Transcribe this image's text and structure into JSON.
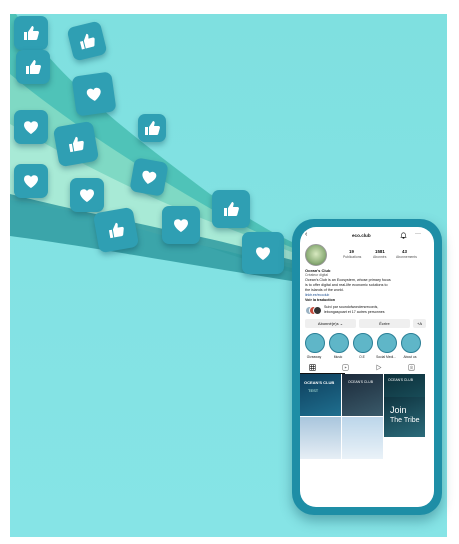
{
  "profile": {
    "username": "eco.club",
    "stats": [
      {
        "value": "19",
        "label": "Publications"
      },
      {
        "value": "1581",
        "label": "Abonnés"
      },
      {
        "value": "43",
        "label": "Abonnements"
      }
    ],
    "name": "Ocean's Club",
    "category": "Créateur digital",
    "bio": [
      "Ocean's Club is an Ecosystem, whose primary focus",
      "is to offer digital and real-life economic solutions to",
      "the islands of the world."
    ],
    "link": "linktr.ee/ecoclub",
    "translation": "Voir la traduction",
    "followed_by": [
      "Suivi par soundofwondersrecords,",
      "lebongaspoart et 17 autres personnes"
    ]
  },
  "buttons": {
    "subscribed": "Abonné(e)s ⌄",
    "write": "Écrire",
    "add_user": "+A"
  },
  "highlights": [
    "Giveaway",
    "Music",
    "O.E",
    "Social Medi...",
    "About us"
  ],
  "posts": [
    {
      "line1": "OCEAN'S CLUB",
      "line2": "TEST"
    },
    {
      "line1": "OCEAN'S CLUB",
      "line2": ""
    },
    {
      "line1": "OCEAN'S CLUB",
      "line2": ""
    },
    {
      "line1": "",
      "line2": ""
    },
    {
      "line1": "",
      "line2": ""
    },
    {
      "line1": "Join",
      "line2": "The Tribe"
    }
  ],
  "colors": {
    "background": "#86e4e6",
    "tile": "#2f9fb3",
    "phone": "#1e8ea6"
  },
  "icons": [
    "like-icon",
    "heart-icon",
    "back-icon",
    "bell-icon",
    "more-icon",
    "grid-icon",
    "reels-icon",
    "play-icon",
    "tagged-icon"
  ]
}
